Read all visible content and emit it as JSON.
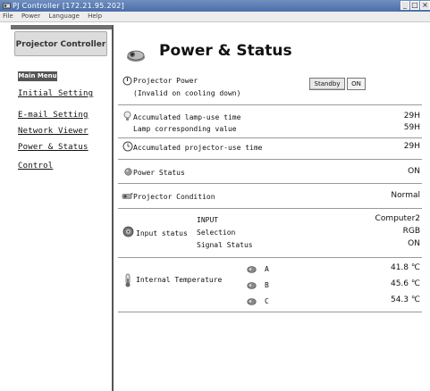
{
  "window": {
    "title": "PJ Controller [172.21.95.202]"
  },
  "menubar": {
    "items": [
      "File",
      "Power",
      "Language",
      "Help"
    ]
  },
  "sidebar": {
    "logo_text": "Projector Controller",
    "main_menu_label": "Main Menu",
    "links": [
      "Initial Setting",
      "E-mail Setting",
      "Network Viewer",
      "Power & Status",
      "Control"
    ]
  },
  "main": {
    "title": "Power & Status",
    "projector_power": {
      "label": "Projector Power",
      "note": "(Invalid on cooling down)",
      "buttons": [
        "Standby",
        "ON"
      ]
    },
    "lamp": {
      "label1": "Accumulated lamp-use time",
      "value1": "29H",
      "label2": "Lamp corresponding value",
      "value2": "59H"
    },
    "projector_use": {
      "label": "Accumulated projector-use time",
      "value": "29H"
    },
    "power_status": {
      "label": "Power Status",
      "value": "ON"
    },
    "projector_condition": {
      "label": "Projector Condition",
      "value": "Normal"
    },
    "input_status": {
      "label": "Input status",
      "rows": [
        {
          "name": "INPUT",
          "value": "Computer2"
        },
        {
          "name": "Selection",
          "value": "RGB"
        },
        {
          "name": "Signal Status",
          "value": "ON"
        }
      ]
    },
    "temperature": {
      "label": "Internal Temperature",
      "sensors": [
        {
          "name": "A",
          "value": "41.8 ℃"
        },
        {
          "name": "B",
          "value": "45.6 ℃"
        },
        {
          "name": "C",
          "value": "54.3 ℃"
        }
      ]
    }
  },
  "colors": {
    "titlebar": "#4b6ea8",
    "sidebar_border": "#555555",
    "divider": "#999999"
  }
}
